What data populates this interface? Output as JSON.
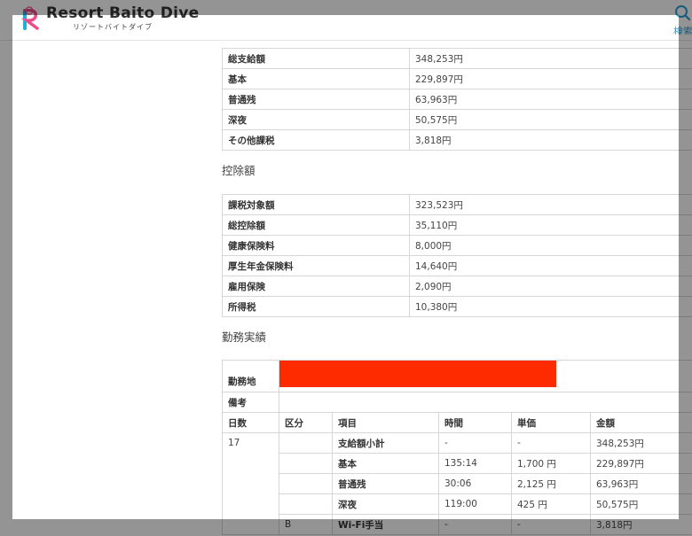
{
  "header": {
    "logo_text": "Resort Baito Dive",
    "logo_subtitle": "リゾートバイトダイブ",
    "search_label": "検索"
  },
  "payments": {
    "rows": [
      {
        "label": "総支給額",
        "value": "348,253円"
      },
      {
        "label": "基本",
        "value": "229,897円"
      },
      {
        "label": "普通残",
        "value": "63,963円"
      },
      {
        "label": "深夜",
        "value": "50,575円"
      },
      {
        "label": "その他課税",
        "value": "3,818円"
      }
    ]
  },
  "deductions": {
    "title": "控除額",
    "rows": [
      {
        "label": "課税対象額",
        "value": "323,523円"
      },
      {
        "label": "総控除額",
        "value": "35,110円"
      },
      {
        "label": "健康保険料",
        "value": "8,000円"
      },
      {
        "label": "厚生年金保険料",
        "value": "14,640円"
      },
      {
        "label": "雇用保険",
        "value": "2,090円"
      },
      {
        "label": "所得税",
        "value": "10,380円"
      }
    ]
  },
  "work_record": {
    "title": "勤務実績",
    "workplace_label": "勤務地",
    "remarks_label": "備考",
    "columns": [
      "日数",
      "区分",
      "項目",
      "時間",
      "単価",
      "金額"
    ],
    "days": "17",
    "rows": [
      {
        "category": "",
        "item": "支給額小計",
        "time": "-",
        "unit_price": "-",
        "amount": "348,253円"
      },
      {
        "category": "",
        "item": "基本",
        "time": "135:14",
        "unit_price": "1,700 円",
        "amount": "229,897円"
      },
      {
        "category": "",
        "item": "普通残",
        "time": "30:06",
        "unit_price": "2,125 円",
        "amount": "63,963円"
      },
      {
        "category": "",
        "item": "深夜",
        "time": "119:00",
        "unit_price": "425 円",
        "amount": "50,575円"
      },
      {
        "category": "B",
        "item": "Wi-Fi手当",
        "time": "-",
        "unit_price": "-",
        "amount": "3,818円"
      }
    ]
  },
  "colors": {
    "redaction": "#fe2a00",
    "accent": "#2a9fd6",
    "border": "#d6d6d6"
  }
}
